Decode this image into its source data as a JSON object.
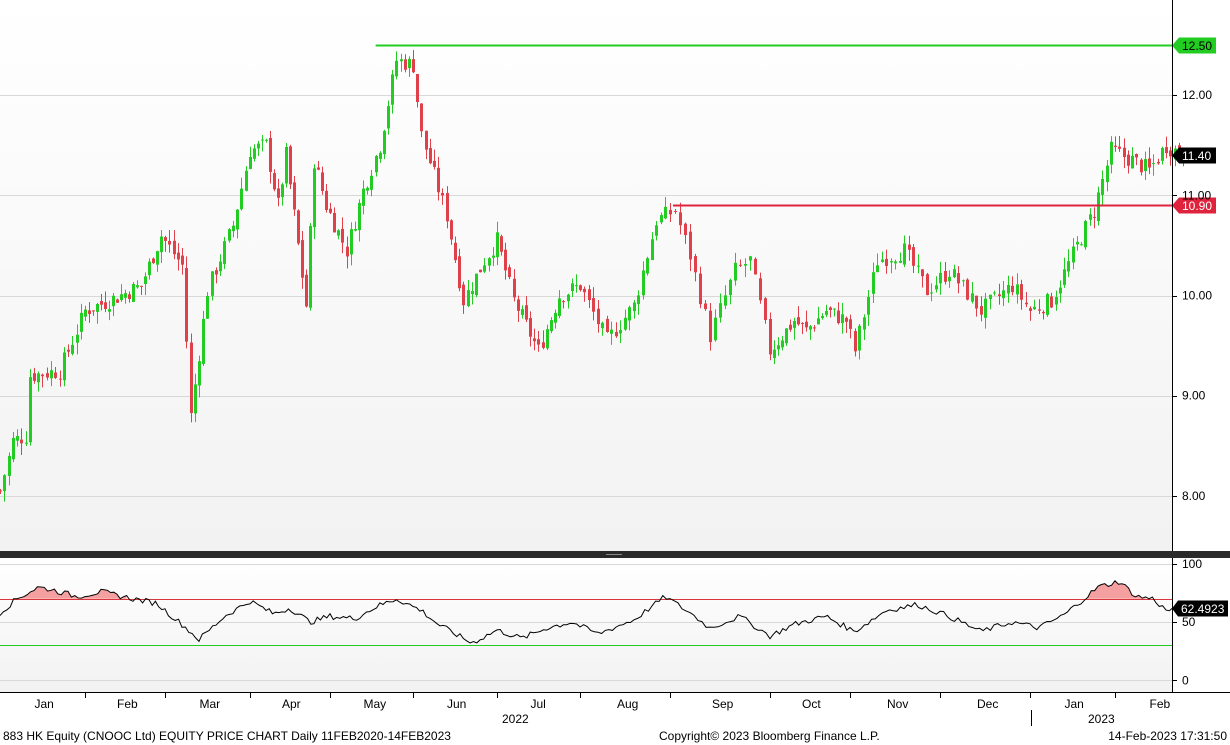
{
  "footer": {
    "left": "883 HK Equity (CNOOC Ltd) EQUITY PRICE CHART  Daily 11FEB2020-14FEB2023",
    "center": "Copyright© 2023 Bloomberg Finance L.P.",
    "right": "14-Feb-2023  17:31:50"
  },
  "colors": {
    "up": "#22cc22",
    "down": "#e0404a",
    "resistance": "#22cc22",
    "support": "#e0233d",
    "rsi_line": "#000000",
    "rsi_upper": "#d9363e",
    "rsi_lower": "#22cc22",
    "rsi_fill": "#f4a0a0",
    "grid": "#d8d8d8"
  },
  "chart_data": [
    {
      "type": "candlestick",
      "title": "",
      "y_ticks": [
        "8.00",
        "9.00",
        "10.00",
        "11.00",
        "12.00"
      ],
      "ylim": [
        7.45,
        12.95
      ],
      "months": [
        {
          "label": "Jan",
          "x": 0
        },
        {
          "label": "Feb",
          "x": 1
        },
        {
          "label": "Mar",
          "x": 2
        },
        {
          "label": "Apr",
          "x": 3
        },
        {
          "label": "May",
          "x": 4
        },
        {
          "label": "Jun",
          "x": 5
        },
        {
          "label": "Jul",
          "x": 6
        },
        {
          "label": "Aug",
          "x": 7
        },
        {
          "label": "Sep",
          "x": 8
        },
        {
          "label": "Oct",
          "x": 9
        },
        {
          "label": "Nov",
          "x": 10
        },
        {
          "label": "Dec",
          "x": 11
        },
        {
          "label": "Jan",
          "x": 12
        },
        {
          "label": "Feb",
          "x": 13
        }
      ],
      "years": [
        {
          "label": "2022",
          "month_index": 6
        },
        {
          "label": "2023",
          "month_index": 12
        }
      ],
      "anchors": [
        {
          "m": 0.0,
          "p": 8.05
        },
        {
          "m": 0.15,
          "p": 8.55
        },
        {
          "m": 0.3,
          "p": 8.6
        },
        {
          "m": 0.35,
          "p": 9.2
        },
        {
          "m": 0.7,
          "p": 9.25
        },
        {
          "m": 1.0,
          "p": 9.85
        },
        {
          "m": 1.3,
          "p": 9.95
        },
        {
          "m": 1.7,
          "p": 10.1
        },
        {
          "m": 1.95,
          "p": 10.6
        },
        {
          "m": 2.2,
          "p": 10.3
        },
        {
          "m": 2.3,
          "p": 8.8
        },
        {
          "m": 2.5,
          "p": 10.05
        },
        {
          "m": 2.8,
          "p": 10.7
        },
        {
          "m": 3.0,
          "p": 11.45
        },
        {
          "m": 3.2,
          "p": 11.5
        },
        {
          "m": 3.35,
          "p": 10.9
        },
        {
          "m": 3.45,
          "p": 11.4
        },
        {
          "m": 3.7,
          "p": 9.9
        },
        {
          "m": 3.8,
          "p": 11.35
        },
        {
          "m": 3.95,
          "p": 10.9
        },
        {
          "m": 4.2,
          "p": 10.45
        },
        {
          "m": 4.4,
          "p": 11.05
        },
        {
          "m": 4.6,
          "p": 11.5
        },
        {
          "m": 4.8,
          "p": 12.35
        },
        {
          "m": 5.0,
          "p": 12.3
        },
        {
          "m": 5.1,
          "p": 11.6
        },
        {
          "m": 5.4,
          "p": 10.8
        },
        {
          "m": 5.6,
          "p": 9.95
        },
        {
          "m": 5.85,
          "p": 10.35
        },
        {
          "m": 6.0,
          "p": 10.55
        },
        {
          "m": 6.2,
          "p": 9.95
        },
        {
          "m": 6.5,
          "p": 9.45
        },
        {
          "m": 6.75,
          "p": 10.0
        },
        {
          "m": 7.0,
          "p": 10.1
        },
        {
          "m": 7.3,
          "p": 9.55
        },
        {
          "m": 7.6,
          "p": 9.9
        },
        {
          "m": 7.85,
          "p": 10.75
        },
        {
          "m": 8.05,
          "p": 10.85
        },
        {
          "m": 8.2,
          "p": 10.4
        },
        {
          "m": 8.4,
          "p": 9.6
        },
        {
          "m": 8.65,
          "p": 10.25
        },
        {
          "m": 8.8,
          "p": 10.35
        },
        {
          "m": 9.0,
          "p": 9.45
        },
        {
          "m": 9.3,
          "p": 9.75
        },
        {
          "m": 9.45,
          "p": 9.65
        },
        {
          "m": 9.7,
          "p": 9.85
        },
        {
          "m": 9.95,
          "p": 9.75
        },
        {
          "m": 10.05,
          "p": 9.45
        },
        {
          "m": 10.3,
          "p": 10.35
        },
        {
          "m": 10.6,
          "p": 10.45
        },
        {
          "m": 10.85,
          "p": 10.05
        },
        {
          "m": 11.1,
          "p": 10.25
        },
        {
          "m": 11.45,
          "p": 9.85
        },
        {
          "m": 11.8,
          "p": 10.1
        },
        {
          "m": 12.0,
          "p": 9.85
        },
        {
          "m": 12.25,
          "p": 9.95
        },
        {
          "m": 12.55,
          "p": 10.5
        },
        {
          "m": 12.75,
          "p": 10.85
        },
        {
          "m": 12.95,
          "p": 11.45
        },
        {
          "m": 13.2,
          "p": 11.35
        },
        {
          "m": 13.4,
          "p": 11.25
        },
        {
          "m": 13.6,
          "p": 11.5
        },
        {
          "m": 13.8,
          "p": 11.4
        }
      ],
      "levels": [
        {
          "price": 12.5,
          "label": "12.50",
          "kind": "resistance",
          "from_month": 4.55
        },
        {
          "price": 10.9,
          "label": "10.90",
          "kind": "support",
          "from_month": 8.03
        },
        {
          "price": 11.4,
          "label": "11.40",
          "kind": "last",
          "from_month": 13.78
        }
      ]
    },
    {
      "type": "line",
      "title": "",
      "y_ticks": [
        "0",
        "50",
        "100"
      ],
      "ylim": [
        -10,
        105
      ],
      "last_label": "62.4923",
      "overbought": 70,
      "oversold": 30,
      "anchors": [
        {
          "m": 0.0,
          "p": 58
        },
        {
          "m": 0.2,
          "p": 70
        },
        {
          "m": 0.45,
          "p": 80
        },
        {
          "m": 0.6,
          "p": 78
        },
        {
          "m": 0.9,
          "p": 72
        },
        {
          "m": 1.2,
          "p": 76
        },
        {
          "m": 1.6,
          "p": 70
        },
        {
          "m": 1.9,
          "p": 66
        },
        {
          "m": 2.2,
          "p": 48
        },
        {
          "m": 2.4,
          "p": 35
        },
        {
          "m": 2.7,
          "p": 55
        },
        {
          "m": 3.0,
          "p": 68
        },
        {
          "m": 3.3,
          "p": 57
        },
        {
          "m": 3.5,
          "p": 62
        },
        {
          "m": 3.75,
          "p": 50
        },
        {
          "m": 4.0,
          "p": 55
        },
        {
          "m": 4.3,
          "p": 53
        },
        {
          "m": 4.55,
          "p": 63
        },
        {
          "m": 4.8,
          "p": 70
        },
        {
          "m": 5.1,
          "p": 60
        },
        {
          "m": 5.3,
          "p": 48
        },
        {
          "m": 5.5,
          "p": 40
        },
        {
          "m": 5.7,
          "p": 32
        },
        {
          "m": 6.0,
          "p": 43
        },
        {
          "m": 6.3,
          "p": 36
        },
        {
          "m": 6.6,
          "p": 45
        },
        {
          "m": 6.9,
          "p": 50
        },
        {
          "m": 7.2,
          "p": 40
        },
        {
          "m": 7.6,
          "p": 52
        },
        {
          "m": 7.95,
          "p": 72
        },
        {
          "m": 8.2,
          "p": 58
        },
        {
          "m": 8.4,
          "p": 45
        },
        {
          "m": 8.7,
          "p": 55
        },
        {
          "m": 9.0,
          "p": 38
        },
        {
          "m": 9.3,
          "p": 48
        },
        {
          "m": 9.7,
          "p": 55
        },
        {
          "m": 10.05,
          "p": 42
        },
        {
          "m": 10.4,
          "p": 60
        },
        {
          "m": 10.75,
          "p": 65
        },
        {
          "m": 11.1,
          "p": 55
        },
        {
          "m": 11.45,
          "p": 42
        },
        {
          "m": 11.8,
          "p": 50
        },
        {
          "m": 12.1,
          "p": 45
        },
        {
          "m": 12.4,
          "p": 56
        },
        {
          "m": 12.6,
          "p": 68
        },
        {
          "m": 12.8,
          "p": 80
        },
        {
          "m": 13.05,
          "p": 85
        },
        {
          "m": 13.25,
          "p": 72
        },
        {
          "m": 13.45,
          "p": 70
        },
        {
          "m": 13.6,
          "p": 60
        },
        {
          "m": 13.78,
          "p": 62.4923
        }
      ]
    }
  ]
}
